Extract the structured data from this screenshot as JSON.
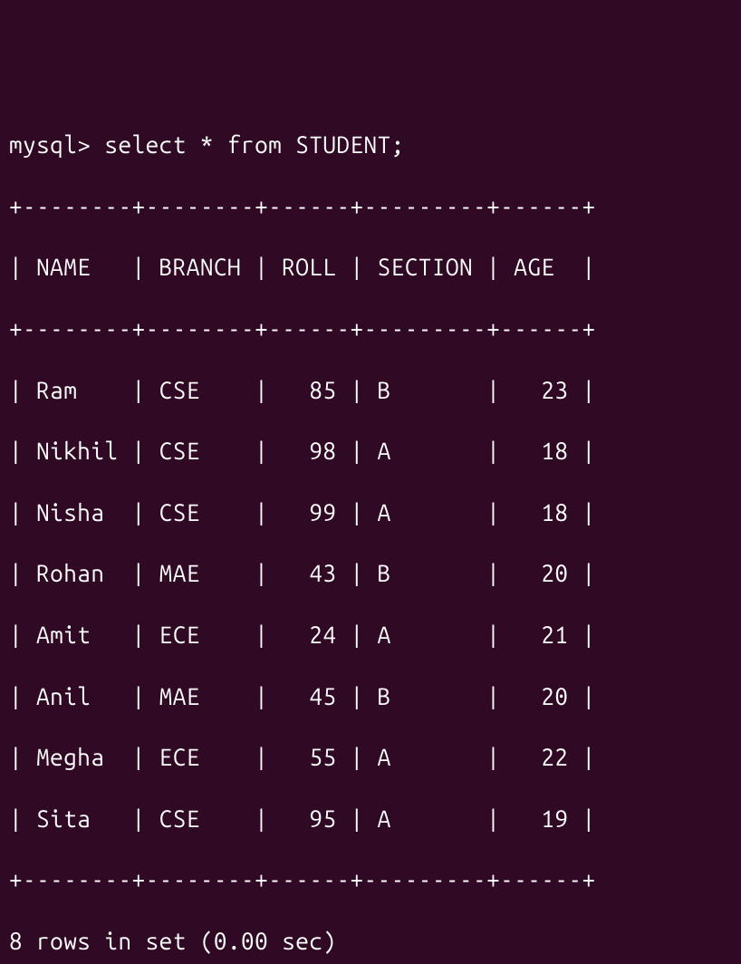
{
  "prompt": "mysql> ",
  "query": "select * from STUDENT;",
  "border_top": "+--------+--------+------+---------+------+",
  "header_line": "| NAME   | BRANCH | ROLL | SECTION | AGE  |",
  "border_mid": "+--------+--------+------+---------+------+",
  "rows": [
    "| Ram    | CSE    |   85 | B       |   23 |",
    "| Nikhil | CSE    |   98 | A       |   18 |",
    "| Nisha  | CSE    |   99 | A       |   18 |",
    "| Rohan  | MAE    |   43 | B       |   20 |",
    "| Amit   | ECE    |   24 | A       |   21 |",
    "| Anil   | MAE    |   45 | B       |   20 |",
    "| Megha  | ECE    |   55 | A       |   22 |",
    "| Sita   | CSE    |   95 | A       |   19 |"
  ],
  "border_bot": "+--------+--------+------+---------+------+",
  "footer": "8 rows in set (0.00 sec)",
  "chart_data": {
    "type": "table",
    "columns": [
      "NAME",
      "BRANCH",
      "ROLL",
      "SECTION",
      "AGE"
    ],
    "data": [
      {
        "NAME": "Ram",
        "BRANCH": "CSE",
        "ROLL": 85,
        "SECTION": "B",
        "AGE": 23
      },
      {
        "NAME": "Nikhil",
        "BRANCH": "CSE",
        "ROLL": 98,
        "SECTION": "A",
        "AGE": 18
      },
      {
        "NAME": "Nisha",
        "BRANCH": "CSE",
        "ROLL": 99,
        "SECTION": "A",
        "AGE": 18
      },
      {
        "NAME": "Rohan",
        "BRANCH": "MAE",
        "ROLL": 43,
        "SECTION": "B",
        "AGE": 20
      },
      {
        "NAME": "Amit",
        "BRANCH": "ECE",
        "ROLL": 24,
        "SECTION": "A",
        "AGE": 21
      },
      {
        "NAME": "Anil",
        "BRANCH": "MAE",
        "ROLL": 45,
        "SECTION": "B",
        "AGE": 20
      },
      {
        "NAME": "Megha",
        "BRANCH": "ECE",
        "ROLL": 55,
        "SECTION": "A",
        "AGE": 22
      },
      {
        "NAME": "Sita",
        "BRANCH": "CSE",
        "ROLL": 95,
        "SECTION": "A",
        "AGE": 19
      }
    ],
    "row_count": 8,
    "elapsed_sec": 0.0
  }
}
